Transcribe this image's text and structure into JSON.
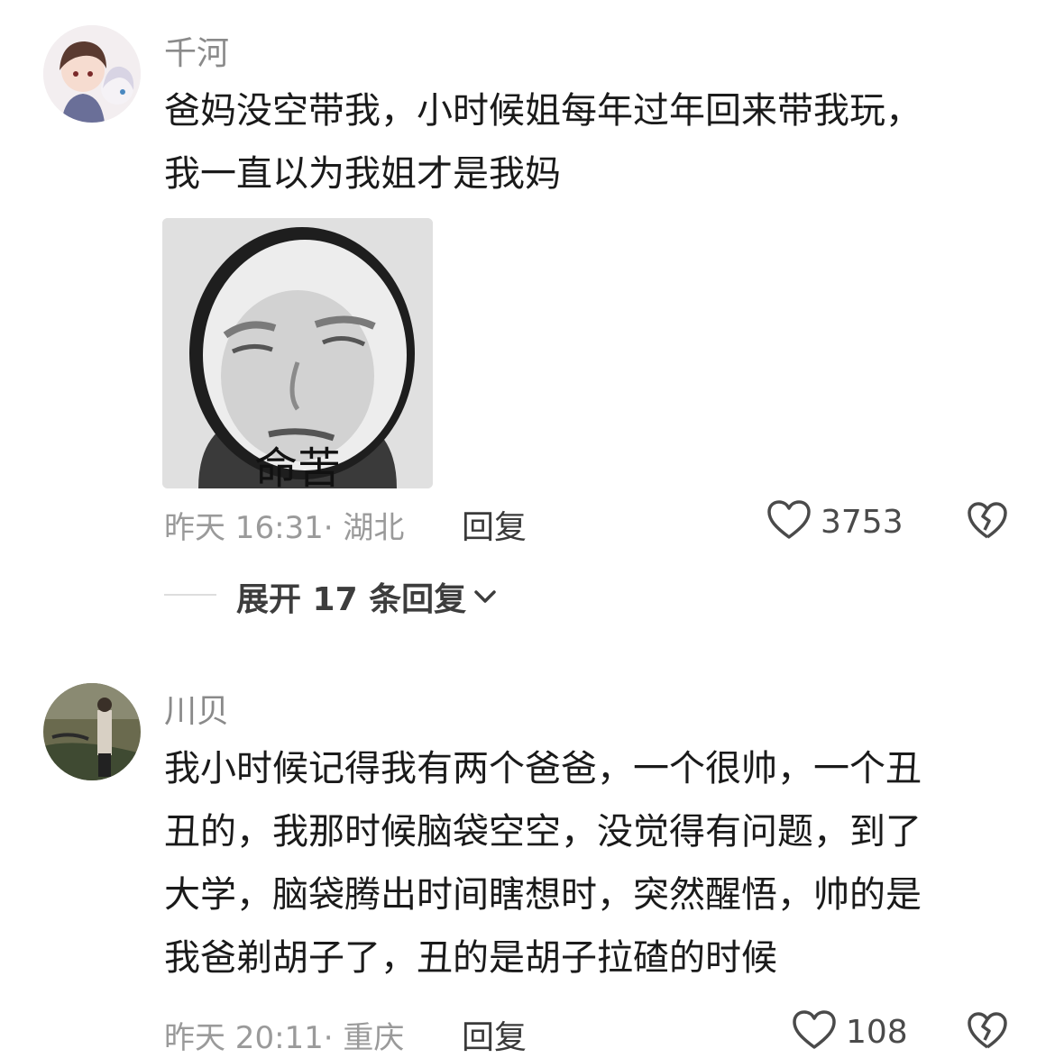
{
  "comments": [
    {
      "username": "千河",
      "lines": [
        "爸妈没空带我，小时候姐每年过年回来带我玩，",
        "我一直以为我姐才是我妈"
      ],
      "sticker_caption": "命苦",
      "meta": "昨天 16:31· 湖北",
      "reply_label": "回复",
      "like_count": "3753",
      "expand_label": "展开 17 条回复"
    },
    {
      "username": "川贝",
      "lines": [
        "我小时候记得我有两个爸爸，一个很帅，一个丑",
        "丑的，我那时候脑袋空空，没觉得有问题，到了",
        "大学，脑袋腾出时间瞎想时，突然醒悟，帅的是",
        "我爸剃胡子了，丑的是胡子拉碴的时候"
      ],
      "meta": "昨天 20:11· 重庆",
      "reply_label": "回复",
      "like_count": "108"
    }
  ],
  "icons": {
    "like": "heart-outline-icon",
    "dislike": "broken-heart-icon",
    "expand": "chevron-down-icon"
  }
}
